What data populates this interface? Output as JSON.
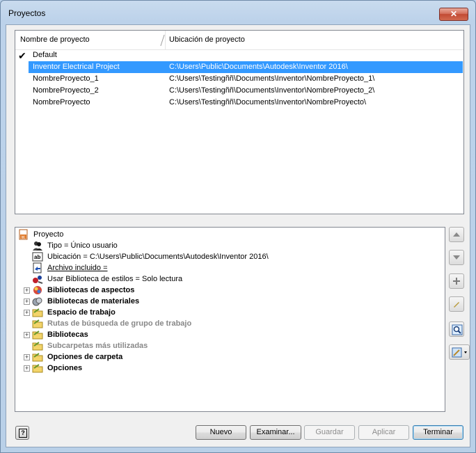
{
  "window": {
    "title": "Proyectos",
    "close_label": "✕"
  },
  "project_list": {
    "columns": [
      "Nombre de proyecto",
      "Ubicación de proyecto"
    ],
    "rows": [
      {
        "name": "Default",
        "location": "",
        "active": true,
        "selected": false
      },
      {
        "name": "Inventor Electrical Project",
        "location": "C:\\Users\\Public\\Documents\\Autodesk\\Inventor 2016\\",
        "active": false,
        "selected": true
      },
      {
        "name": "NombreProyecto_1",
        "location": "C:\\Users\\Testingññ\\Documents\\Inventor\\NombreProyecto_1\\",
        "active": false,
        "selected": false
      },
      {
        "name": "NombreProyecto_2",
        "location": "C:\\Users\\Testingññ\\Documents\\Inventor\\NombreProyecto_2\\",
        "active": false,
        "selected": false
      },
      {
        "name": "NombreProyecto",
        "location": "C:\\Users\\Testingññ\\Documents\\Inventor\\NombreProyecto\\",
        "active": false,
        "selected": false
      }
    ]
  },
  "tree": {
    "root": "Proyecto",
    "items": [
      {
        "label": "Tipo = Único usuario",
        "icon": "users-icon"
      },
      {
        "label": "Ubicación = C:\\Users\\Public\\Documents\\Autodesk\\Inventor 2016\\",
        "icon": "text-field-icon"
      },
      {
        "label": "Archivo incluido = ",
        "icon": "included-file-icon"
      },
      {
        "label": "Usar Biblioteca de estilos = Solo lectura",
        "icon": "style-library-icon"
      },
      {
        "label": "Bibliotecas de aspectos",
        "icon": "appearance-library-icon"
      },
      {
        "label": "Bibliotecas de materiales",
        "icon": "material-library-icon"
      },
      {
        "label": "Espacio de trabajo",
        "icon": "folder-icon"
      },
      {
        "label": "Rutas de búsqueda de grupo de trabajo",
        "icon": "folder-icon"
      },
      {
        "label": "Bibliotecas",
        "icon": "folder-icon"
      },
      {
        "label": "Subcarpetas más utilizadas",
        "icon": "folder-icon"
      },
      {
        "label": "Opciones de carpeta",
        "icon": "folder-icon"
      },
      {
        "label": "Opciones",
        "icon": "folder-icon"
      }
    ]
  },
  "side_toolbar": [
    "move-up-icon",
    "move-down-icon",
    "add-icon",
    "edit-icon",
    "find-icon",
    "edit-dropdown-icon"
  ],
  "buttons": {
    "help": "?",
    "new": "Nuevo",
    "browse": "Examinar...",
    "save": "Guardar",
    "apply": "Aplicar",
    "finish": "Terminar"
  }
}
